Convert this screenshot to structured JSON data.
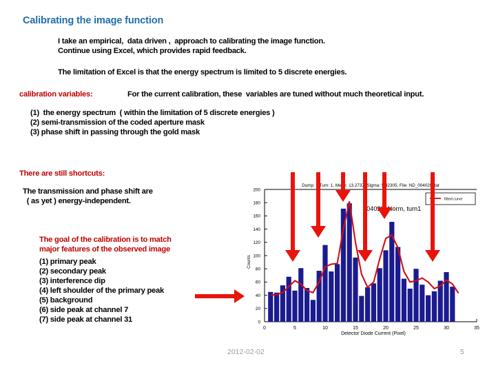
{
  "slide": {
    "title": "Calibrating the image function",
    "intro": "I take an empirical,  data driven ,  approach to calibrating the image function.\nContinue using Excel, which provides rapid feedback.",
    "limitation": "The limitation of Excel is that the energy spectrum is limited to 5 discrete energies.",
    "calibration_variables_label": "calibration variables:",
    "calibration_variables_text": "For the current calibration, these  variables are tuned without much theoretical input.",
    "variables_list": "(1)  the energy spectrum  ( within the limitation of 5 discrete energies )\n(2) semi-transmission of the coded aperture mask\n(3) phase shift in passing through the gold mask",
    "shortcuts_heading": "There are still shortcuts:",
    "shortcuts_body": "The transmission and phase shift are\n  ( as yet ) energy-independent.",
    "goal_heading": "The goal of the calibration is to match\nmajor features of the observed image",
    "goal_list": "(1) primary peak\n(2) secondary peak\n(3) interference dip\n(4) left shoulder of the primary peak\n(5) background\n(6) side peak at channel 7\n(7) side peak at channel 31"
  },
  "footer": {
    "date": "2012-02-02",
    "page_number": "5"
  },
  "colors": {
    "title_blue": "#1F6FA8",
    "accent_red": "#C00000",
    "arrow_red": "#E8140C",
    "bar_navy": "#1B1B8F",
    "curve_red": "#CC1111"
  },
  "annotations": {
    "down_arrows": [
      {
        "name": "arrow-left-shoulder",
        "x": 425,
        "tip_y": 380
      },
      {
        "name": "arrow-secondary-peak",
        "x": 462,
        "tip_y": 345
      },
      {
        "name": "arrow-primary-peak",
        "x": 498,
        "tip_y": 293
      },
      {
        "name": "arrow-interference-dip",
        "x": 530,
        "tip_y": 380
      },
      {
        "name": "arrow-side-peak-7",
        "x": 558,
        "tip_y": 318
      },
      {
        "name": "arrow-side-peak-31",
        "x": 628,
        "tip_y": 380
      }
    ],
    "right_arrow": {
      "name": "arrow-background",
      "x1": 283,
      "x2": 355,
      "y": 430
    }
  },
  "chart_data": {
    "type": "bar",
    "title": "Dump: 1 Turn: 1,  Mean: 13.2737,  Sigma: 5.42305,  File: ND_004029.dat",
    "series_label": "004029, Norm, turn1",
    "legend": [
      {
        "label": "fitted curve",
        "color": "#CC1111"
      }
    ],
    "xlabel": "Detector Diode Current (Pixel)",
    "ylabel": "Counts",
    "xlim": [
      0,
      35
    ],
    "ylim": [
      0,
      200
    ],
    "xticks": [
      0,
      5,
      10,
      15,
      20,
      25,
      30,
      35
    ],
    "yticks": [
      0,
      20,
      40,
      60,
      80,
      100,
      120,
      140,
      160,
      180,
      200
    ],
    "grid": false,
    "categories": [
      1,
      2,
      3,
      4,
      5,
      6,
      7,
      8,
      9,
      10,
      11,
      12,
      13,
      14,
      15,
      16,
      17,
      18,
      19,
      20,
      21,
      22,
      23,
      24,
      25,
      26,
      27,
      28,
      29,
      30,
      31,
      32
    ],
    "values": [
      45,
      44,
      55,
      68,
      47,
      81,
      51,
      33,
      77,
      116,
      76,
      87,
      171,
      179,
      97,
      39,
      52,
      58,
      81,
      108,
      151,
      113,
      65,
      50,
      80,
      56,
      40,
      46,
      62,
      75,
      53,
      0
    ],
    "series": [
      {
        "name": "counts-bars",
        "type": "bar",
        "values": [
          45,
          44,
          55,
          68,
          47,
          81,
          51,
          33,
          77,
          116,
          76,
          87,
          171,
          179,
          97,
          39,
          52,
          58,
          81,
          108,
          151,
          113,
          65,
          50,
          80,
          56,
          40,
          46,
          62,
          75,
          53,
          0
        ]
      },
      {
        "name": "fitted curve",
        "type": "line",
        "values": [
          40,
          41,
          44,
          53,
          62,
          57,
          47,
          44,
          60,
          83,
          87,
          88,
          140,
          182,
          120,
          72,
          52,
          60,
          95,
          126,
          131,
          112,
          76,
          60,
          62,
          66,
          60,
          50,
          54,
          63,
          57,
          43
        ]
      }
    ]
  }
}
